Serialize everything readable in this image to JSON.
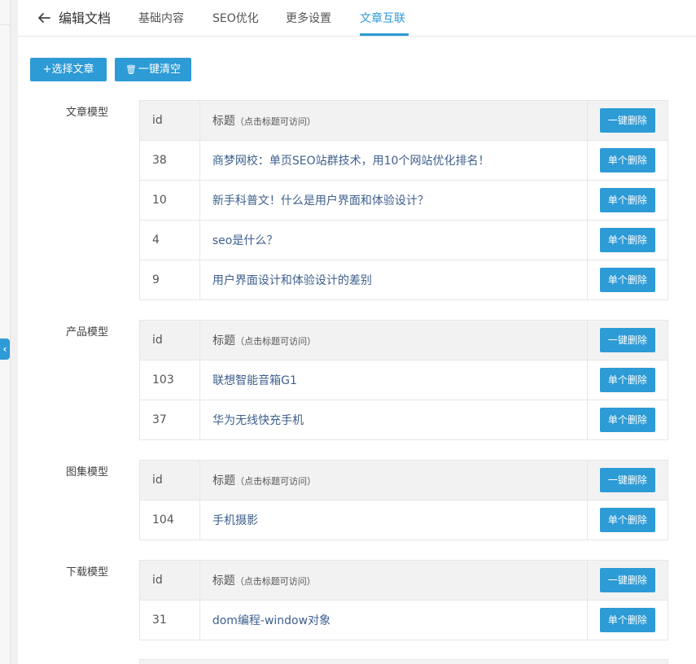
{
  "header": {
    "title": "编辑文档",
    "tabs": [
      {
        "label": "基础内容"
      },
      {
        "label": "SEO优化"
      },
      {
        "label": "更多设置"
      },
      {
        "label": "文章互联"
      }
    ],
    "active_tab": "文章互联"
  },
  "toolbar": {
    "select_label": "+选择文章",
    "clear_label": "一键清空"
  },
  "table_header": {
    "id": "id",
    "title": "标题",
    "title_hint": "（点击标题可访问）",
    "delete_all": "一键删除",
    "delete_one": "单个删除"
  },
  "models": [
    {
      "label": "文章模型",
      "rows": [
        {
          "id": "38",
          "title": "商梦网校：单页SEO站群技术，用10个网站优化排名！"
        },
        {
          "id": "10",
          "title": "新手科普文！什么是用户界面和体验设计？"
        },
        {
          "id": "4",
          "title": "seo是什么？"
        },
        {
          "id": "9",
          "title": "用户界面设计和体验设计的差别"
        }
      ]
    },
    {
      "label": "产品模型",
      "rows": [
        {
          "id": "103",
          "title": "联想智能音箱G1"
        },
        {
          "id": "37",
          "title": "华为无线快充手机"
        }
      ]
    },
    {
      "label": "图集模型",
      "rows": [
        {
          "id": "104",
          "title": "手机摄影"
        }
      ]
    },
    {
      "label": "下载模型",
      "rows": [
        {
          "id": "31",
          "title": "dom编程-window对象"
        }
      ]
    }
  ],
  "colors": {
    "accent": "#2d9bd6",
    "link": "#3e5f8e",
    "header_bg": "#f2f2f2"
  }
}
